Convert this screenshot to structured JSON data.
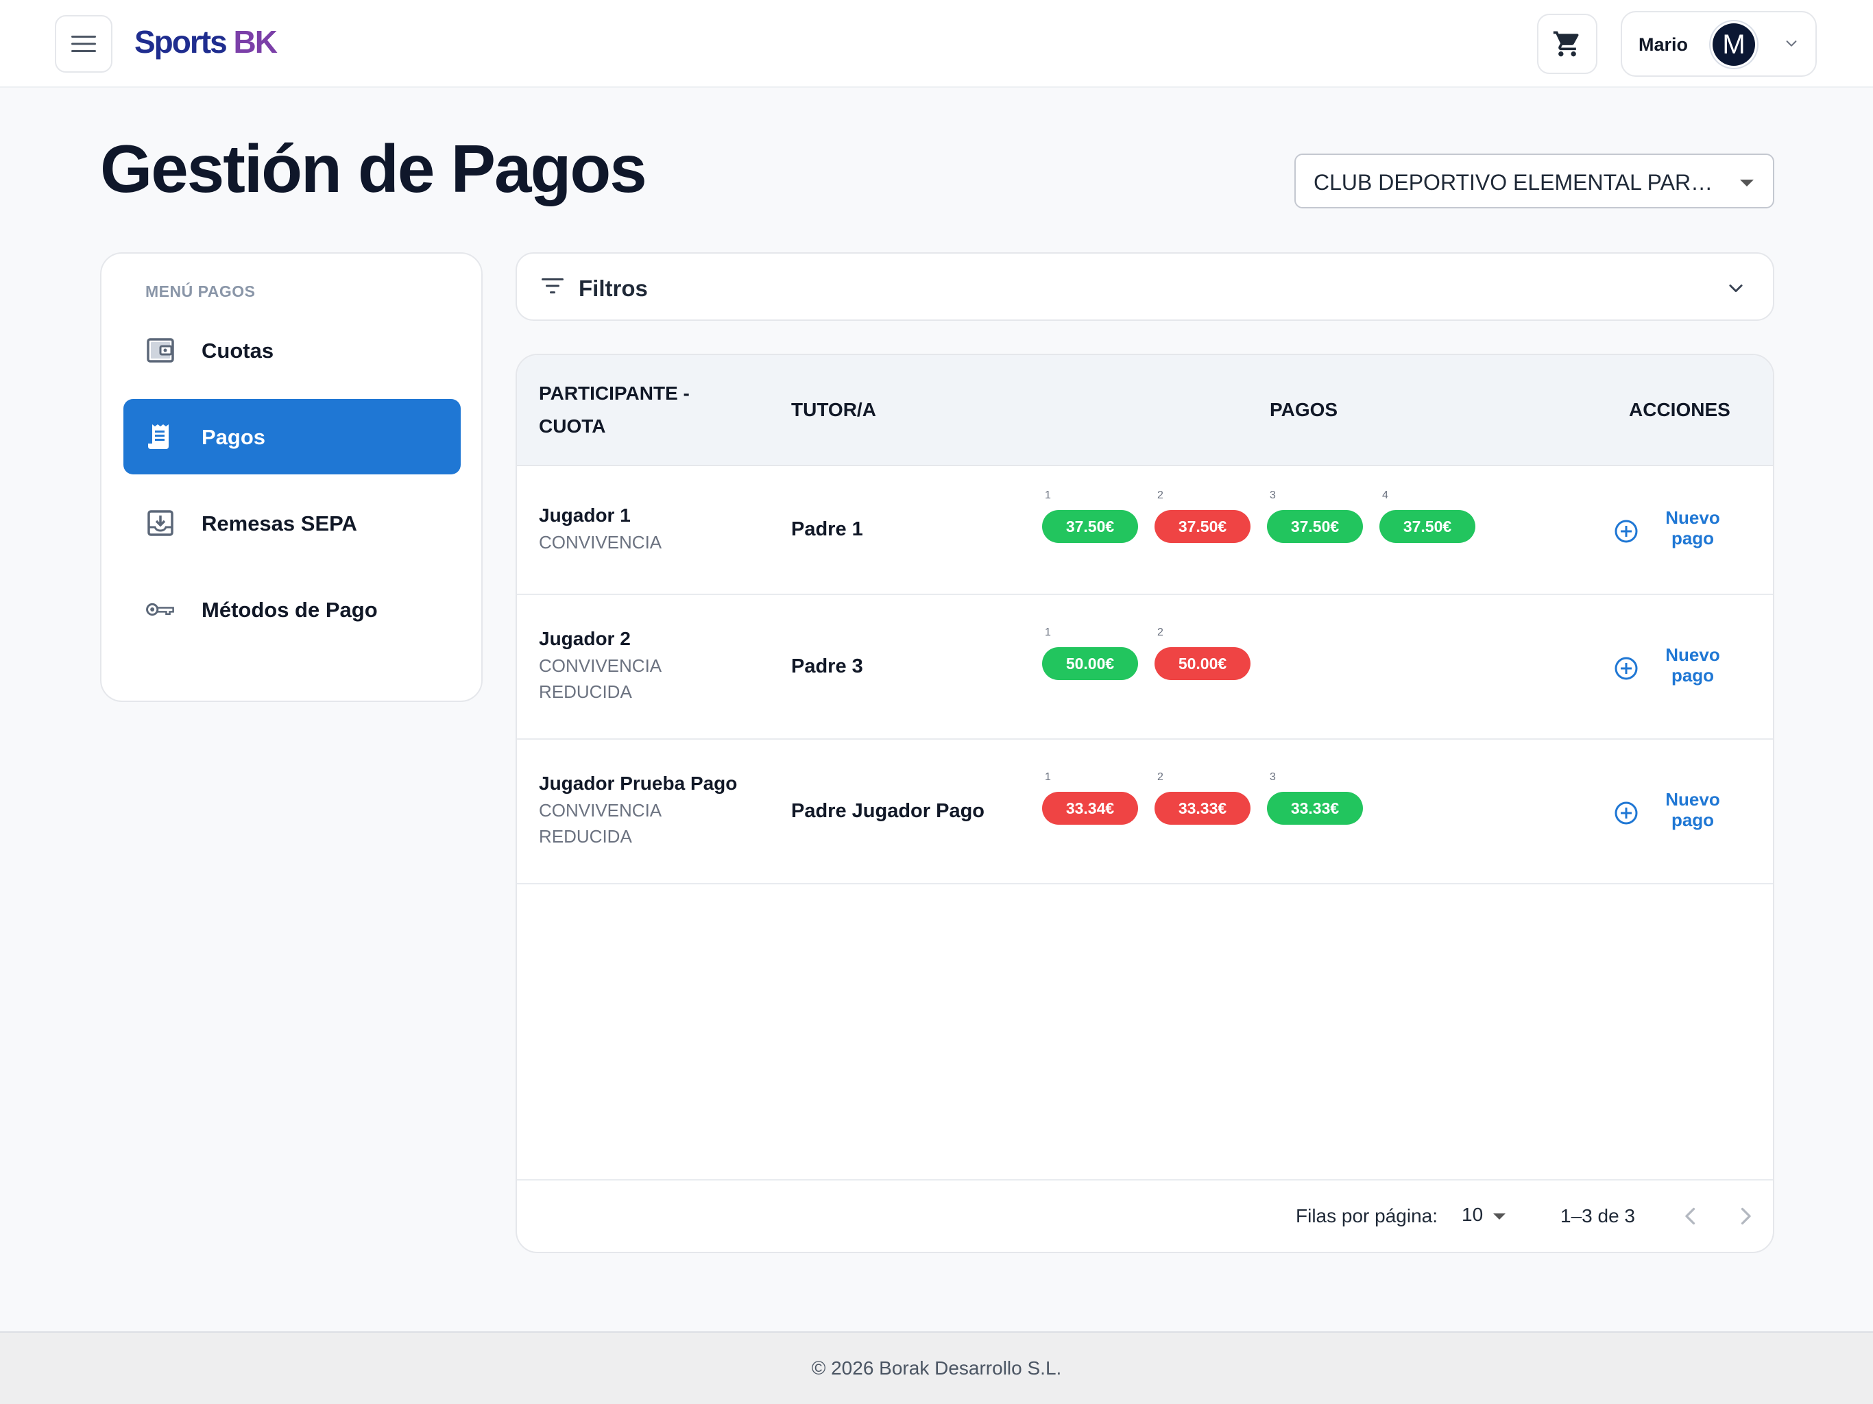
{
  "brand": {
    "part1": "Sports",
    "part2": "BK"
  },
  "user": {
    "name": "Mario",
    "initial": "M"
  },
  "page": {
    "title": "Gestión de Pagos"
  },
  "club_select": {
    "value": "CLUB DEPORTIVO ELEMENTAL PARQ..."
  },
  "sidebar": {
    "title": "MENÚ PAGOS",
    "items": [
      {
        "label": "Cuotas",
        "icon": "wallet-icon",
        "active": false
      },
      {
        "label": "Pagos",
        "icon": "receipt-icon",
        "active": true
      },
      {
        "label": "Remesas SEPA",
        "icon": "download-tray-icon",
        "active": false
      },
      {
        "label": "Métodos de Pago",
        "icon": "key-icon",
        "active": false
      }
    ]
  },
  "filters": {
    "label": "Filtros"
  },
  "table": {
    "headers": {
      "participante_line1": "PARTICIPANTE -",
      "participante_line2": "CUOTA",
      "tutor": "TUTOR/A",
      "pagos": "PAGOS",
      "acciones": "ACCIONES"
    },
    "rows": [
      {
        "name": "Jugador 1",
        "cuota": "CONVIVENCIA",
        "tutor": "Padre 1",
        "payments": [
          {
            "n": "1",
            "amount": "37.50€",
            "status": "paid"
          },
          {
            "n": "2",
            "amount": "37.50€",
            "status": "unpaid"
          },
          {
            "n": "3",
            "amount": "37.50€",
            "status": "paid"
          },
          {
            "n": "4",
            "amount": "37.50€",
            "status": "paid"
          }
        ],
        "action_line1": "Nuevo",
        "action_line2": "pago"
      },
      {
        "name": "Jugador 2",
        "cuota": "CONVIVENCIA REDUCIDA",
        "tutor": "Padre 3",
        "payments": [
          {
            "n": "1",
            "amount": "50.00€",
            "status": "paid"
          },
          {
            "n": "2",
            "amount": "50.00€",
            "status": "unpaid"
          }
        ],
        "action_line1": "Nuevo",
        "action_line2": "pago"
      },
      {
        "name": "Jugador Prueba Pago",
        "cuota": "CONVIVENCIA REDUCIDA",
        "tutor": "Padre Jugador Pago",
        "payments": [
          {
            "n": "1",
            "amount": "33.34€",
            "status": "unpaid"
          },
          {
            "n": "2",
            "amount": "33.33€",
            "status": "unpaid"
          },
          {
            "n": "3",
            "amount": "33.33€",
            "status": "paid"
          }
        ],
        "action_line1": "Nuevo",
        "action_line2": "pago"
      }
    ]
  },
  "pagination": {
    "rows_label": "Filas por página:",
    "rows_value": "10",
    "range": "1–3 de 3"
  },
  "footer": {
    "text": "© 2026 Borak Desarrollo S.L."
  },
  "colors": {
    "primary": "#1f77d4",
    "paid": "#22c55e",
    "unpaid": "#ef4444",
    "brand_blue": "#1f2d8f",
    "brand_purple": "#7b3fa8"
  }
}
